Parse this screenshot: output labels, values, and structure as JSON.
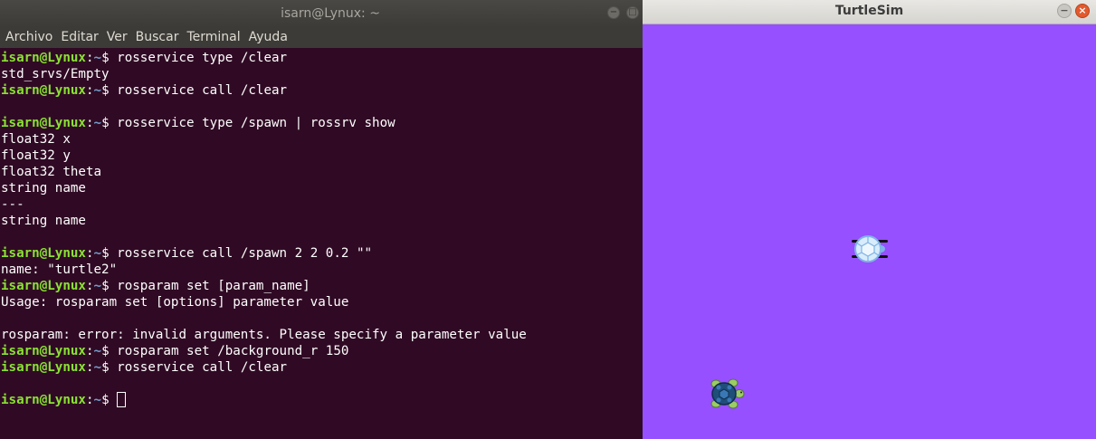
{
  "terminal": {
    "title": "isarn@Lynux: ~",
    "menu": [
      "Archivo",
      "Editar",
      "Ver",
      "Buscar",
      "Terminal",
      "Ayuda"
    ],
    "prompt_user": "isarn@Lynux",
    "prompt_sep": ":",
    "prompt_path": "~",
    "prompt_symbol": "$ ",
    "lines": [
      {
        "type": "cmd",
        "text": "rosservice type /clear"
      },
      {
        "type": "out",
        "text": "std_srvs/Empty"
      },
      {
        "type": "cmd",
        "text": "rosservice call /clear"
      },
      {
        "type": "out",
        "text": ""
      },
      {
        "type": "cmd",
        "text": "rosservice type /spawn | rossrv show"
      },
      {
        "type": "out",
        "text": "float32 x"
      },
      {
        "type": "out",
        "text": "float32 y"
      },
      {
        "type": "out",
        "text": "float32 theta"
      },
      {
        "type": "out",
        "text": "string name"
      },
      {
        "type": "out",
        "text": "---"
      },
      {
        "type": "out",
        "text": "string name"
      },
      {
        "type": "out",
        "text": ""
      },
      {
        "type": "cmd",
        "text": "rosservice call /spawn 2 2 0.2 \"\""
      },
      {
        "type": "out",
        "text": "name: \"turtle2\""
      },
      {
        "type": "cmd",
        "text": "rosparam set [param_name]"
      },
      {
        "type": "out",
        "text": "Usage: rosparam set [options] parameter value"
      },
      {
        "type": "out",
        "text": ""
      },
      {
        "type": "out",
        "text": "rosparam: error: invalid arguments. Please specify a parameter value"
      },
      {
        "type": "cmd",
        "text": "rosparam set /background_r 150"
      },
      {
        "type": "cmd",
        "text": "rosservice call /clear"
      },
      {
        "type": "out",
        "text": ""
      },
      {
        "type": "cursor",
        "text": ""
      }
    ]
  },
  "turtlesim": {
    "title": "TurtleSim",
    "background_color": "#9650ff",
    "turtles": [
      {
        "name": "turtle1",
        "icon": "turtle-icon-light"
      },
      {
        "name": "turtle2",
        "icon": "turtle-icon-dark"
      }
    ]
  }
}
